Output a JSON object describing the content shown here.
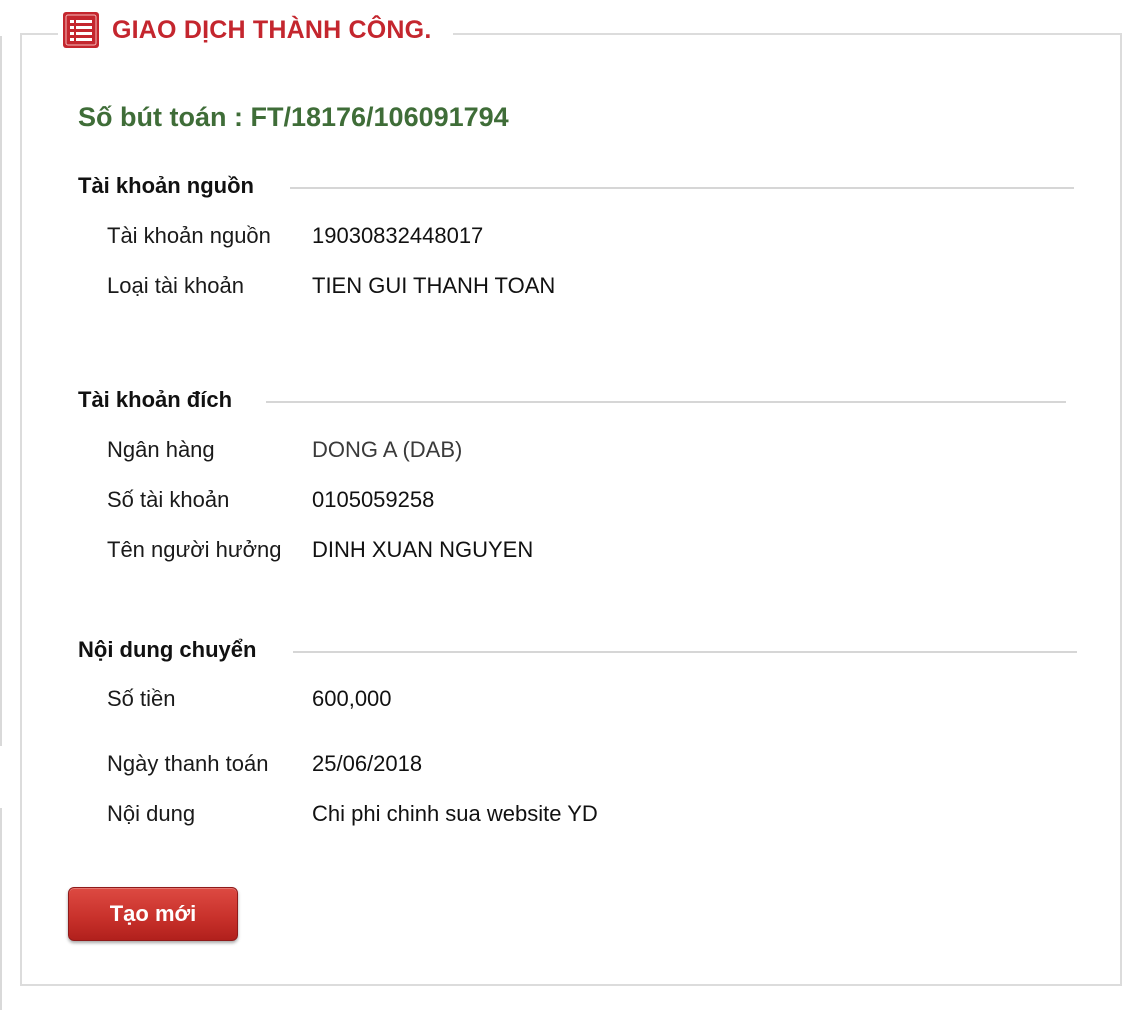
{
  "colors": {
    "accent_red": "#c4262e",
    "reference_green": "#3f6d38",
    "button_red": "#c9322c"
  },
  "header": {
    "icon": "list-icon",
    "title": "GIAO DỊCH THÀNH CÔNG."
  },
  "reference": {
    "label": "Số bút toán : FT/18176/106091794"
  },
  "source_account": {
    "heading": "Tài khoản nguồn",
    "rows": [
      {
        "label": "Tài khoản nguồn",
        "value": "19030832448017"
      },
      {
        "label": "Loại tài khoản",
        "value": "TIEN GUI THANH TOAN"
      }
    ]
  },
  "destination_account": {
    "heading": "Tài khoản đích",
    "rows": [
      {
        "label": "Ngân hàng",
        "value": "DONG A (DAB)"
      },
      {
        "label": "Số tài khoản",
        "value": "0105059258"
      },
      {
        "label": "Tên người hưởng",
        "value": "DINH XUAN NGUYEN"
      }
    ]
  },
  "transfer_content": {
    "heading": "Nội dung chuyển",
    "rows": [
      {
        "label": "Số tiền",
        "value": "600,000"
      },
      {
        "label": "Ngày thanh toán",
        "value": "25/06/2018"
      },
      {
        "label": "Nội dung",
        "value": "Chi phi chinh sua website YD"
      }
    ]
  },
  "actions": {
    "new_label": "Tạo mới"
  }
}
